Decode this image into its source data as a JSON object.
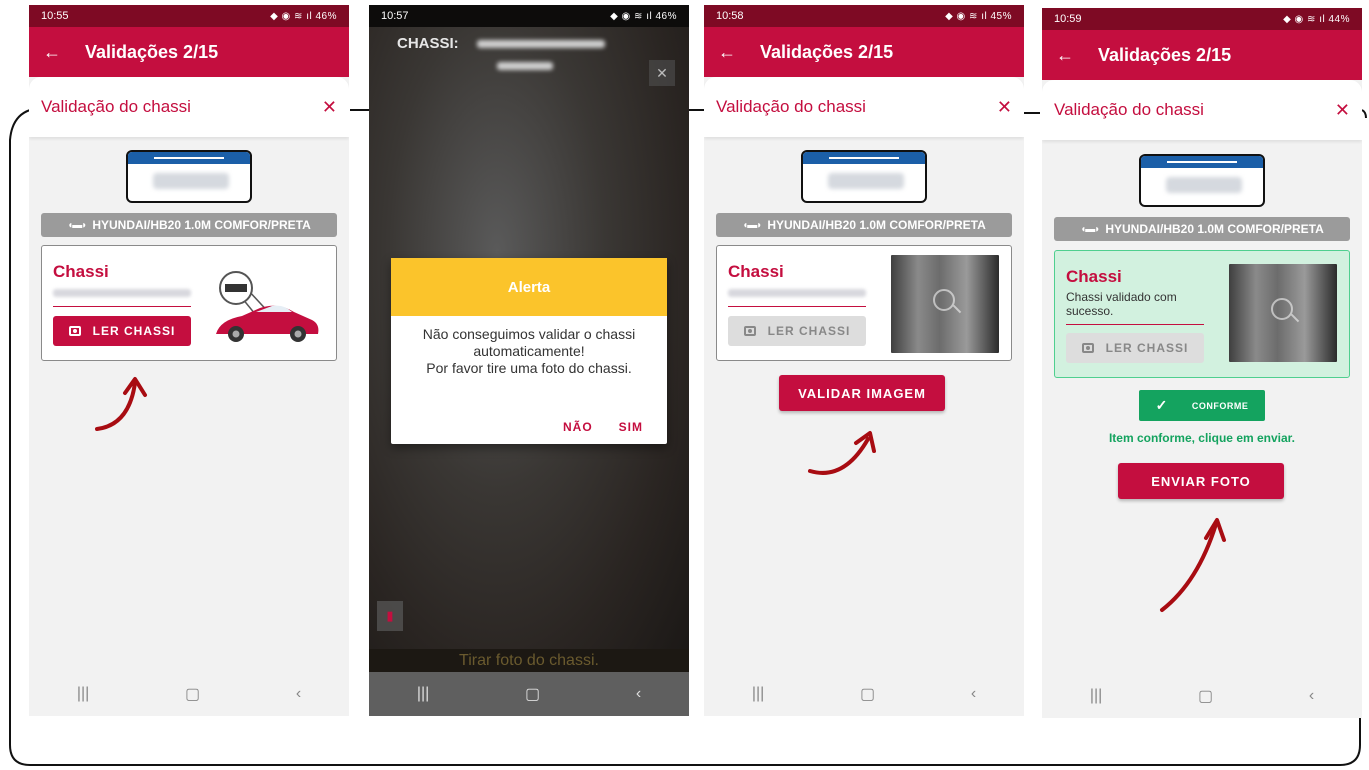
{
  "colors": {
    "primary": "#c40e3f",
    "status_bar": "#7e0a24",
    "success": "#14a35f",
    "alert": "#fbc42b"
  },
  "screens": [
    {
      "time": "10:55",
      "battery": "46%",
      "appbar_title": "Validações 2/15",
      "sheet_title": "Validação do chassi",
      "model": "HYUNDAI/HB20 1.0M COMFOR/PRETA",
      "card_title": "Chassi",
      "read_button": "LER CHASSI"
    },
    {
      "time": "10:57",
      "battery": "46%",
      "camera_label": "CHASSI:",
      "alert_title": "Alerta",
      "alert_line1": "Não conseguimos validar o chassi",
      "alert_line2": "automaticamente!",
      "alert_line3": "Por favor tire uma foto do chassi.",
      "alert_no": "NÃO",
      "alert_yes": "SIM",
      "caption": "Tirar foto do chassi."
    },
    {
      "time": "10:58",
      "battery": "45%",
      "appbar_title": "Validações 2/15",
      "sheet_title": "Validação do chassi",
      "model": "HYUNDAI/HB20 1.0M COMFOR/PRETA",
      "card_title": "Chassi",
      "read_button": "LER CHASSI",
      "validate_button": "VALIDAR IMAGEM"
    },
    {
      "time": "10:59",
      "battery": "44%",
      "appbar_title": "Validações 2/15",
      "sheet_title": "Validação do chassi",
      "model": "HYUNDAI/HB20 1.0M COMFOR/PRETA",
      "card_title": "Chassi",
      "success_message": "Chassi validado com sucesso.",
      "read_button": "LER CHASSI",
      "conforme_label": "CONFORME",
      "conforme_message": "Item conforme, clique em enviar.",
      "send_button": "ENVIAR FOTO"
    }
  ]
}
